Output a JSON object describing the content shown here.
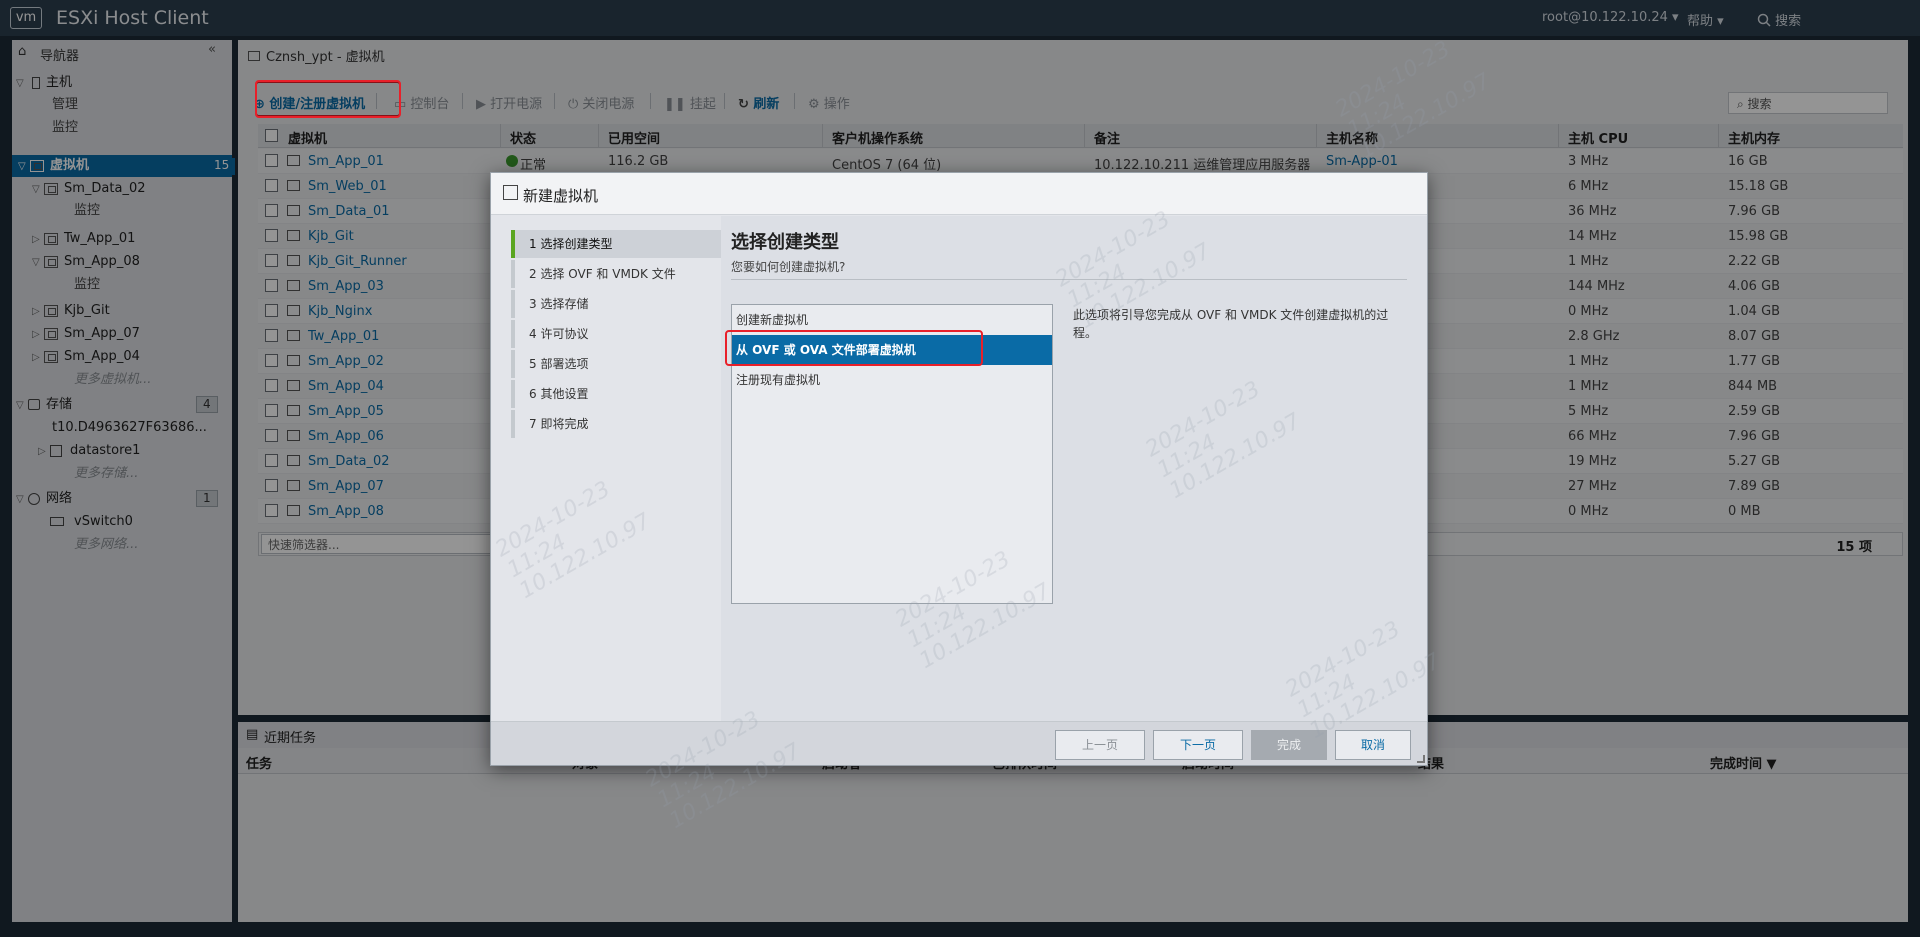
{
  "header": {
    "logo": "vm",
    "title": "ESXi Host Client",
    "user": "root@10.122.10.24",
    "help": "帮助",
    "search": "搜索"
  },
  "navigator": {
    "title": "导航器",
    "host": {
      "label": "主机",
      "children": [
        "管理",
        "监控"
      ]
    },
    "vms": {
      "label": "虚拟机",
      "count": "15",
      "items": [
        {
          "name": "Sm_Data_02",
          "sub": "监控"
        },
        {
          "name": "Tw_App_01"
        },
        {
          "name": "Sm_App_08",
          "sub": "监控"
        },
        {
          "name": "Kjb_Git"
        },
        {
          "name": "Sm_App_07"
        },
        {
          "name": "Sm_App_04"
        }
      ],
      "more": "更多虚拟机..."
    },
    "storage": {
      "label": "存储",
      "count": "4",
      "items": [
        "t10.D4963627F63686...",
        "datastore1"
      ],
      "more": "更多存储..."
    },
    "network": {
      "label": "网络",
      "count": "1",
      "items": [
        "vSwitch0"
      ],
      "more": "更多网络..."
    }
  },
  "main": {
    "breadcrumb": "Cznsh_ypt - 虚拟机",
    "toolbar": {
      "create": "创建/注册虚拟机",
      "console": "控制台",
      "power_on": "打开电源",
      "power_off": "关闭电源",
      "suspend": "挂起",
      "refresh": "刷新",
      "actions": "操作"
    },
    "search_placeholder": "搜索",
    "columns": [
      "虚拟机",
      "状态",
      "已用空间",
      "客户机操作系统",
      "备注",
      "主机名称",
      "主机 CPU",
      "主机内存"
    ],
    "rows": [
      {
        "name": "Sm_App_01",
        "status": "正常",
        "space": "116.2 GB",
        "os": "CentOS 7 (64 位)",
        "notes": "10.122.10.211 运维管理应用服务器",
        "host": "Sm-App-01",
        "cpu": "3 MHz",
        "mem": "16 GB"
      },
      {
        "name": "Sm_Web_01",
        "cpu": "6 MHz",
        "mem": "15.18 GB"
      },
      {
        "name": "Sm_Data_01",
        "cpu": "36 MHz",
        "mem": "7.96 GB"
      },
      {
        "name": "Kjb_Git",
        "cpu": "14 MHz",
        "mem": "15.98 GB"
      },
      {
        "name": "Kjb_Git_Runner",
        "cpu": "1 MHz",
        "mem": "2.22 GB"
      },
      {
        "name": "Sm_App_03",
        "cpu": "144 MHz",
        "mem": "4.06 GB"
      },
      {
        "name": "Kjb_Nginx",
        "cpu": "0 MHz",
        "mem": "1.04 GB"
      },
      {
        "name": "Tw_App_01",
        "cpu": "2.8 GHz",
        "mem": "8.07 GB"
      },
      {
        "name": "Sm_App_02",
        "cpu": "1 MHz",
        "mem": "1.77 GB"
      },
      {
        "name": "Sm_App_04",
        "cpu": "1 MHz",
        "mem": "844 MB"
      },
      {
        "name": "Sm_App_05",
        "cpu": "5 MHz",
        "mem": "2.59 GB"
      },
      {
        "name": "Sm_App_06",
        "cpu": "66 MHz",
        "mem": "7.96 GB"
      },
      {
        "name": "Sm_Data_02",
        "cpu": "19 MHz",
        "mem": "5.27 GB"
      },
      {
        "name": "Sm_App_07",
        "cpu": "27 MHz",
        "mem": "7.89 GB"
      },
      {
        "name": "Sm_App_08",
        "cpu": "0 MHz",
        "mem": "0 MB"
      }
    ],
    "quick_filter": "快速筛选器...",
    "item_count": "15 项"
  },
  "tasks": {
    "title": "近期任务",
    "columns": [
      "任务",
      "对象",
      "启动者",
      "已排队时间",
      "启动时间",
      "结果",
      "完成时间 ▼"
    ]
  },
  "dialog": {
    "title": "新建虚拟机",
    "steps": [
      "1  选择创建类型",
      "2  选择 OVF 和 VMDK 文件",
      "3  选择存储",
      "4  许可协议",
      "5  部署选项",
      "6  其他设置",
      "7  即将完成"
    ],
    "heading": "选择创建类型",
    "subheading": "您要如何创建虚拟机?",
    "options": [
      "创建新虚拟机",
      "从 OVF 或 OVA 文件部署虚拟机",
      "注册现有虚拟机"
    ],
    "selected_option": 1,
    "description": "此选项将引导您完成从 OVF 和 VMDK 文件创建虚拟机的过程。",
    "buttons": {
      "back": "上一页",
      "next": "下一页",
      "finish": "完成",
      "cancel": "取消"
    }
  },
  "watermark": "2024-10-23\n11:24\n10.122.10.97",
  "colors": {
    "accent": "#0a6ba6",
    "highlight": "#e8202a",
    "step_active": "#5aa520"
  }
}
